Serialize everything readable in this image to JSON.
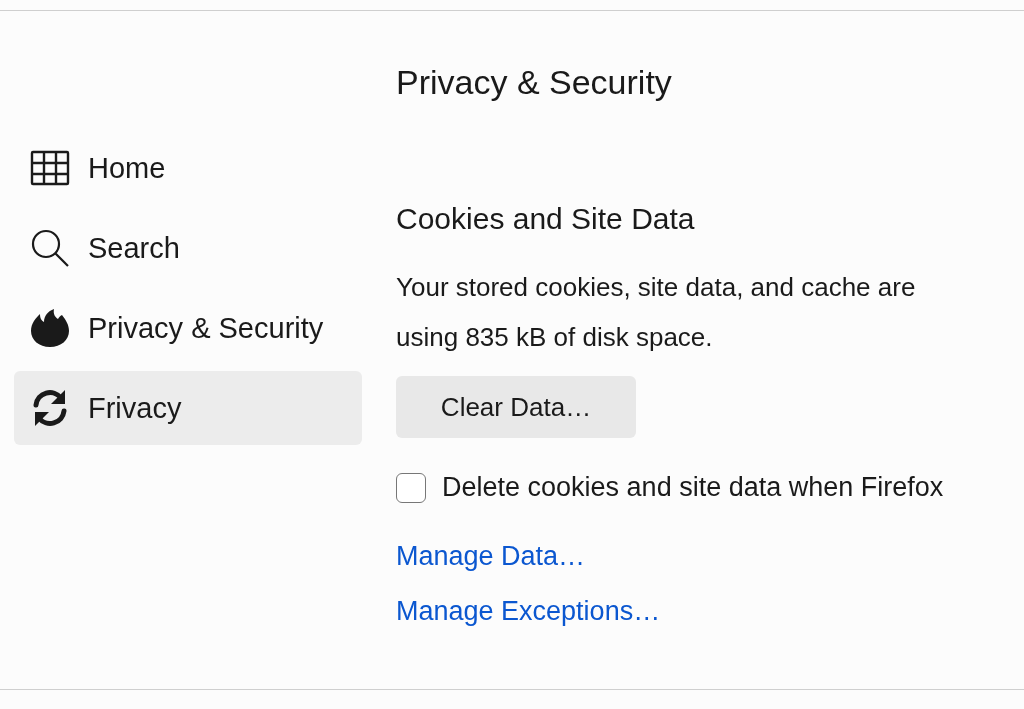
{
  "sidebar": {
    "items": [
      {
        "label": "Home",
        "selected": false
      },
      {
        "label": "Search",
        "selected": false
      },
      {
        "label": "Privacy & Security",
        "selected": false
      },
      {
        "label": "Frivacy",
        "selected": true
      }
    ]
  },
  "page_title": "Privacy & Security",
  "section": {
    "title": "Cookies and Site Data",
    "description": "Your stored cookies, site data, and cache are using 835 kB of disk space.",
    "clear_button": "Clear Data…",
    "checkbox": {
      "label": "Delete cookies and site data when Firefox",
      "checked": false
    },
    "links": [
      "Manage Data…",
      "Manage Exceptions…"
    ]
  }
}
